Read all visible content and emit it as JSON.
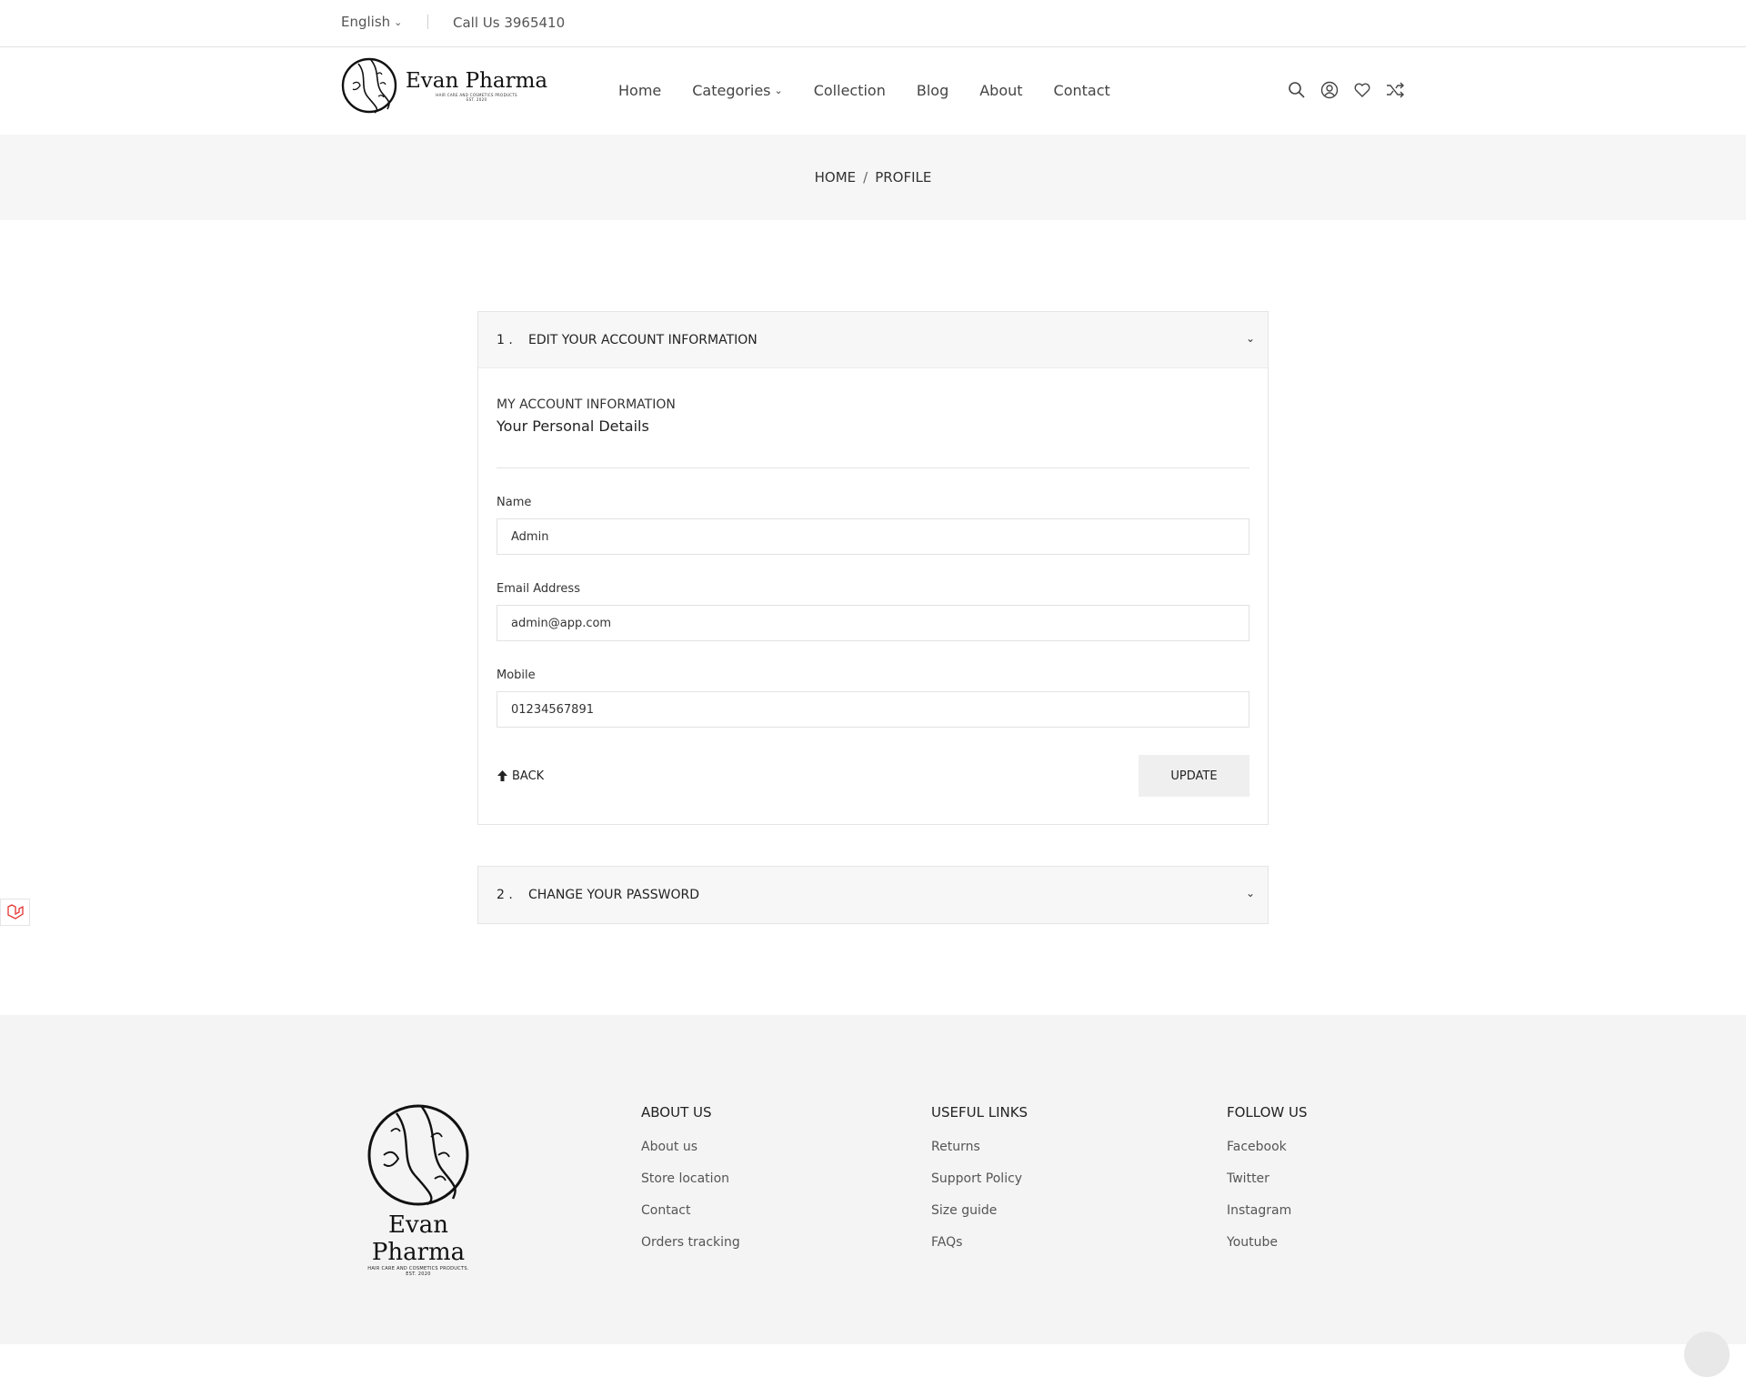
{
  "topbar": {
    "language": "English",
    "call": "Call Us 3965410"
  },
  "header": {
    "brand_name": "Evan Pharma",
    "brand_tagline": "HAIR CARE AND COSMETICS PRODUCTS",
    "brand_est": "EST. 2020",
    "nav": [
      {
        "label": "Home"
      },
      {
        "label": "Categories"
      },
      {
        "label": "Collection"
      },
      {
        "label": "Blog"
      },
      {
        "label": "About"
      },
      {
        "label": "Contact"
      }
    ],
    "icons": [
      "search-icon",
      "user-icon",
      "heart-icon",
      "shuffle-icon"
    ]
  },
  "breadcrumb": {
    "home": "HOME",
    "separator": "/",
    "current": "PROFILE"
  },
  "account_panel": {
    "number": "1 .",
    "title": "EDIT YOUR ACCOUNT INFORMATION",
    "section_title": "MY ACCOUNT INFORMATION",
    "section_subtitle": "Your Personal Details",
    "fields": {
      "name_label": "Name",
      "name_value": "Admin",
      "email_label": "Email Address",
      "email_value": "admin@app.com",
      "mobile_label": "Mobile",
      "mobile_value": "01234567891"
    },
    "back_label": "BACK",
    "update_label": "UPDATE"
  },
  "password_panel": {
    "number": "2 .",
    "title": "CHANGE YOUR PASSWORD"
  },
  "footer": {
    "brand_name": "Evan Pharma",
    "brand_tagline": "HAIR CARE AND COSMETICS PRODUCTS.",
    "brand_est": "EST. 2020",
    "about": {
      "heading": "ABOUT US",
      "links": [
        "About us",
        "Store location",
        "Contact",
        "Orders tracking"
      ]
    },
    "useful": {
      "heading": "USEFUL LINKS",
      "links": [
        "Returns",
        "Support Policy",
        "Size guide",
        "FAQs"
      ]
    },
    "follow": {
      "heading": "FOLLOW US",
      "links": [
        "Facebook",
        "Twitter",
        "Instagram",
        "Youtube"
      ]
    }
  },
  "colors": {
    "banner_bg": "#f6f6f6",
    "footer_bg": "#f4f4f5",
    "button_bg": "#efefef",
    "badge_accent": "#e3342f"
  }
}
